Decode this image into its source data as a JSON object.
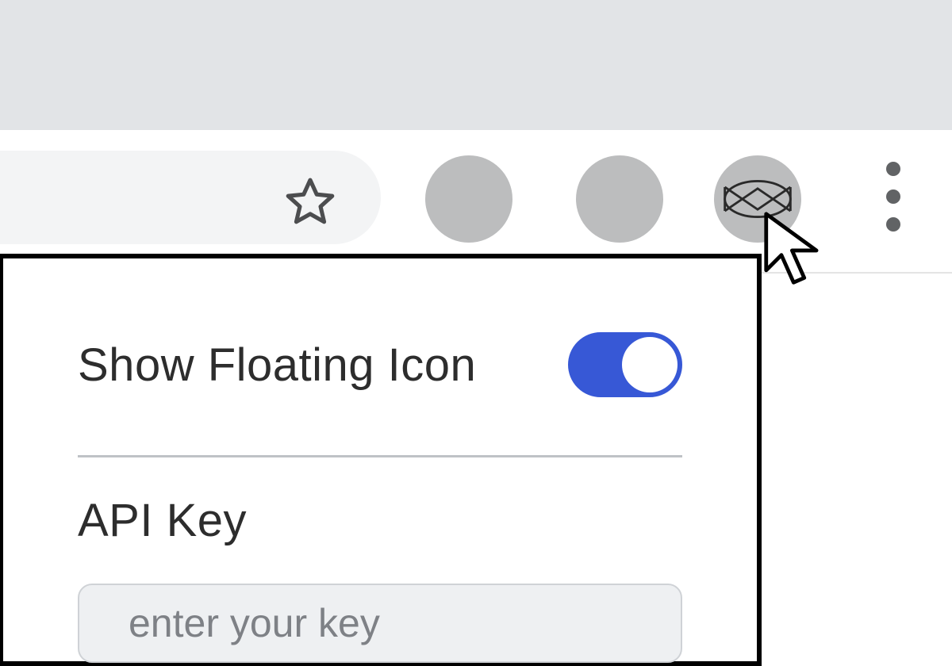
{
  "colors": {
    "accent": "#3758d6",
    "toolbar_bg": "#e2e4e7",
    "icon_placeholder": "#bcbdbe"
  },
  "toolbar": {
    "icons": {
      "star": "star-icon",
      "button1": "round-placeholder-icon",
      "button2": "round-placeholder-icon",
      "button3": "extension-icon",
      "kebab": "more-icon"
    }
  },
  "cursor": {
    "type": "pointer"
  },
  "popup": {
    "show_floating_icon": {
      "label": "Show Floating Icon",
      "value": true
    },
    "api_key": {
      "label": "API Key",
      "placeholder": "enter your key",
      "value": ""
    }
  }
}
